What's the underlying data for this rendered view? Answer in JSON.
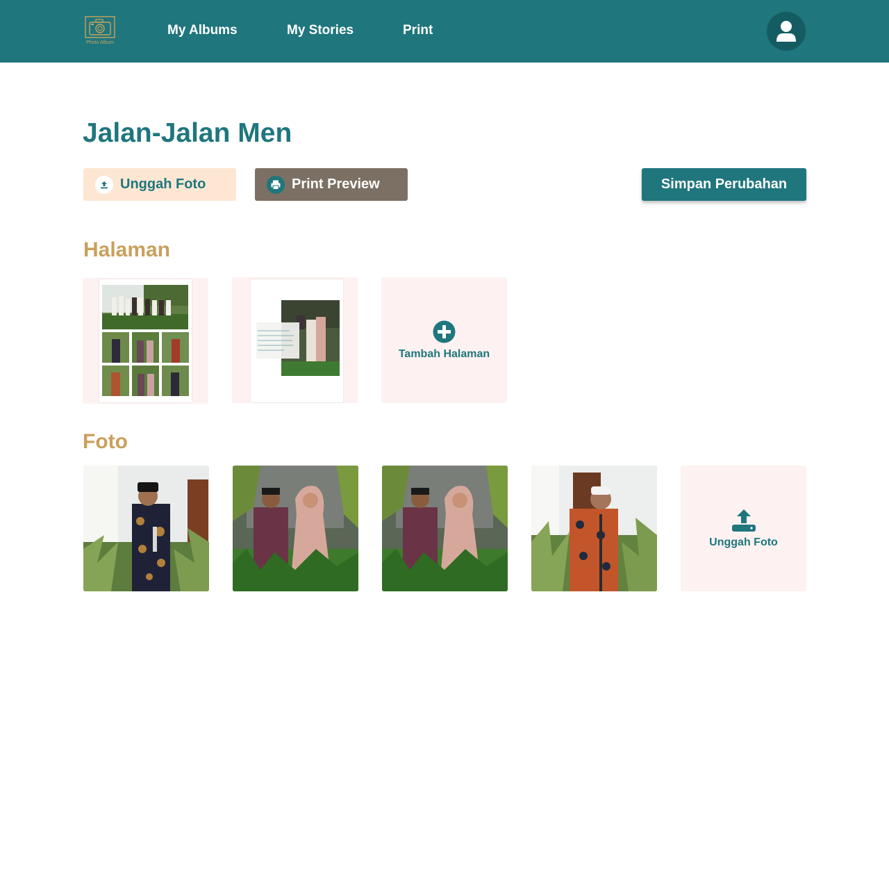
{
  "header": {
    "logo_text": "Photo Album",
    "nav": [
      "My Albums",
      "My Stories",
      "Print"
    ]
  },
  "album": {
    "title": "Jalan-Jalan Men"
  },
  "actions": {
    "upload_label": "Unggah Foto",
    "print_label": "Print Preview",
    "save_label": "Simpan Perubahan"
  },
  "pages_section": {
    "title": "Halaman",
    "add_label": "Tambah Halaman",
    "page_caption": "Senyum bahagia diatas segala lembar kenangan hari ini, satu momen yang tak terlupakan di hari istimewa ini."
  },
  "photos_section": {
    "title": "Foto",
    "upload_label": "Unggah Foto"
  },
  "colors": {
    "primary": "#1f767d",
    "accent_gold": "#c9a05c",
    "card_bg": "#fdf2f1",
    "upload_btn_bg": "#fde7d3",
    "print_btn_bg": "#7b7063"
  },
  "icons": [
    "camera-logo-icon",
    "user-icon",
    "upload-icon",
    "printer-icon",
    "plus-circle-icon",
    "upload-tray-icon"
  ]
}
